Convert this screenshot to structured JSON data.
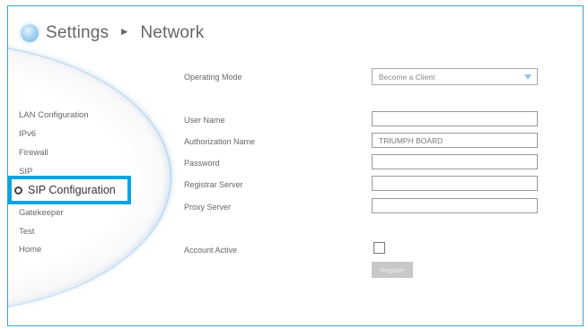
{
  "header": {
    "title": "Settings",
    "separator": "►",
    "subtitle": "Network"
  },
  "nav": {
    "items": [
      {
        "label": "LAN Configuration"
      },
      {
        "label": "IPv6"
      },
      {
        "label": "Firewall"
      },
      {
        "label": "SIP"
      },
      {
        "label": "SIP Configuration",
        "active": true
      },
      {
        "label": "Gatekeeper"
      },
      {
        "label": "Test"
      },
      {
        "label": "Home"
      }
    ]
  },
  "form": {
    "operating_mode": {
      "label": "Operating Mode",
      "value": "Become a Client"
    },
    "user_name": {
      "label": "User Name",
      "value": ""
    },
    "authorization_name": {
      "label": "Authorization Name",
      "value": "TRIUMPH BOARD"
    },
    "password": {
      "label": "Password",
      "value": ""
    },
    "registrar_server": {
      "label": "Registrar Server",
      "value": ""
    },
    "proxy_server": {
      "label": "Proxy Server",
      "value": ""
    },
    "account_active": {
      "label": "Account Active",
      "checked": false
    },
    "register_button": {
      "label": "Register"
    }
  },
  "colors": {
    "accent": "#0aa5e0",
    "frame_border": "#3aa3d6",
    "dropdown_arrow": "#8fc7ee"
  }
}
